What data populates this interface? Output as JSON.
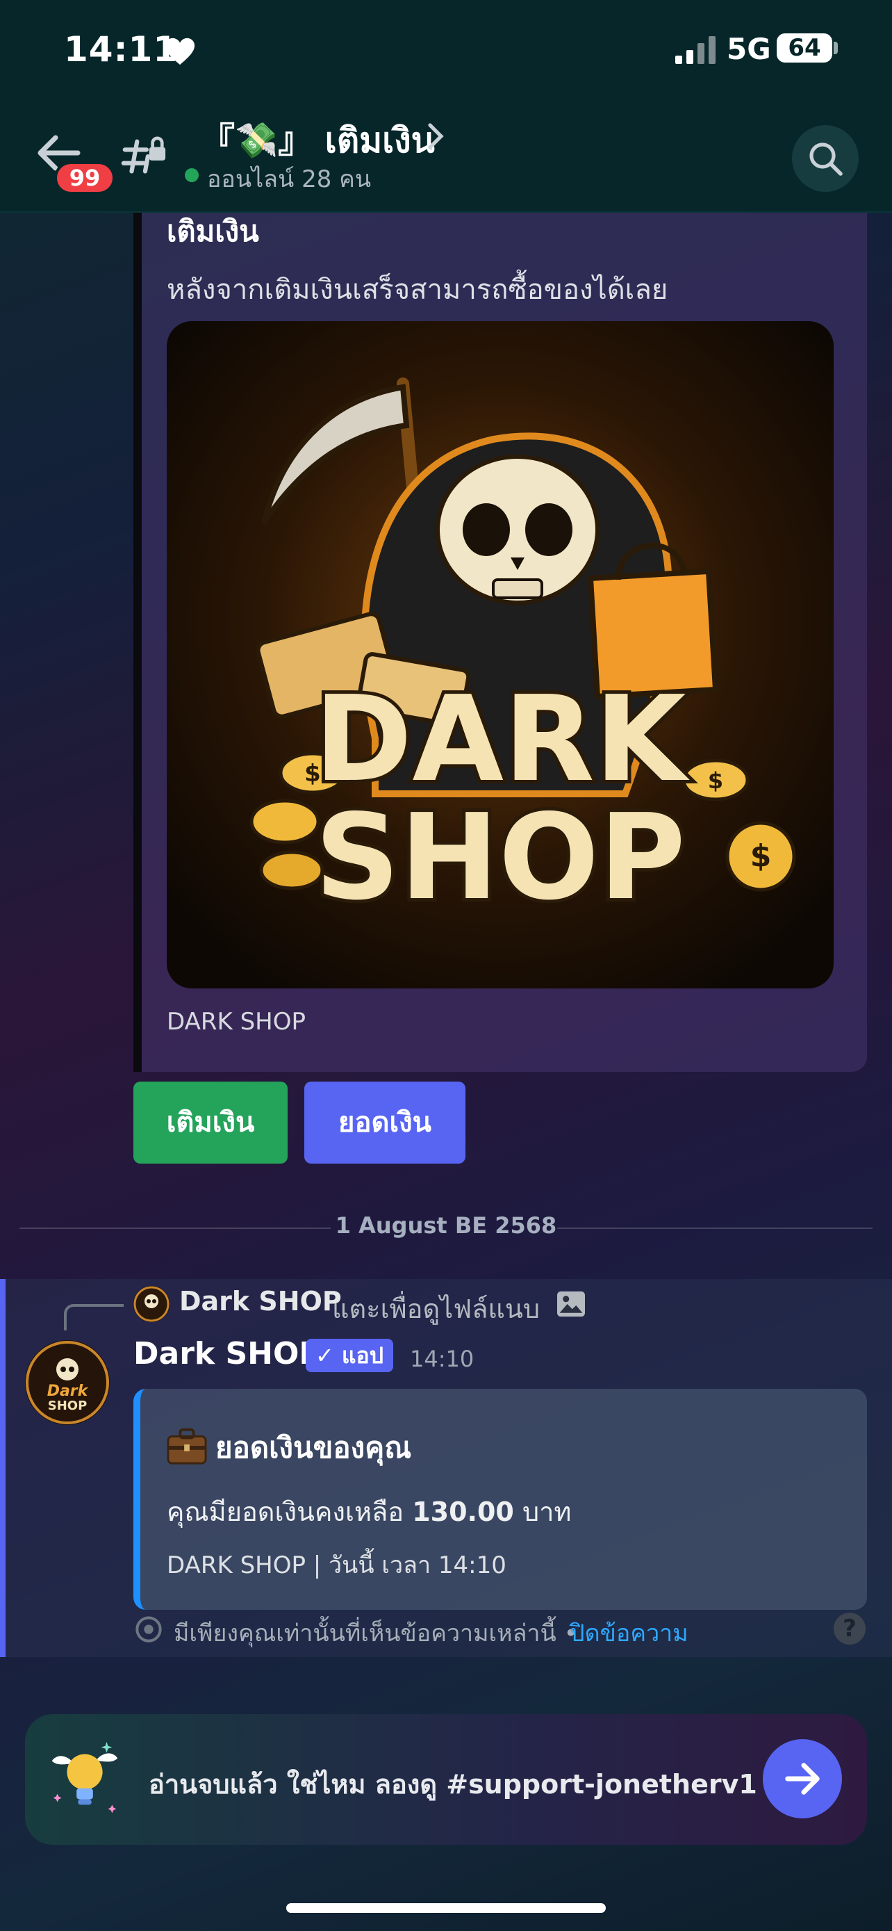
{
  "status_bar": {
    "time": "14:11",
    "network": "5G",
    "battery": "64"
  },
  "header": {
    "unread_count": "99",
    "channel_title": "『💸』 เติมเงิน",
    "online_text": "ออนไลน์ 28 คน"
  },
  "embed": {
    "title": "เติมเงิน",
    "description": "หลังจากเติมเงินเสร็จสามารถซื้อของได้เลย",
    "image_text_line1": "DARK",
    "image_text_line2": "SHOP",
    "footer": "DARK SHOP"
  },
  "buttons": {
    "topup": "เติมเงิน",
    "balance": "ยอดเงิน"
  },
  "date_divider": "1 August BE 2568",
  "message": {
    "reply_author": "Dark SHOP",
    "reply_text": "แตะเพื่อดูไฟล์แนบ",
    "author": "Dark SHOP",
    "app_badge": "✓ แอป",
    "timestamp": "14:10",
    "avatar_text_1": "Dark",
    "avatar_text_2": "SHOP",
    "embed_title": "ยอดเงินของคุณ",
    "embed_desc_prefix": "คุณมียอดเงินคงเหลือ",
    "embed_amount": "130.00",
    "embed_unit": "บาท",
    "embed_footer": "DARK SHOP | วันนี้ เวลา 14:10",
    "ephemeral_text": "มีเพียงคุณเท่านั้นที่เห็นข้อความเหล่านี้ •",
    "dismiss_link": "ปิดข้อความ",
    "help": "?"
  },
  "prompt": {
    "text": "อ่านจบแล้ว ใช่ไหม ลองดู #support-jonetherv1"
  },
  "colors": {
    "topup_button": "#24a35a",
    "balance_button": "#5865f2",
    "badge_red": "#ef3e44",
    "online_green": "#23a55a",
    "link_blue": "#2fa8ff",
    "embed_accent": "#1e90ff"
  }
}
